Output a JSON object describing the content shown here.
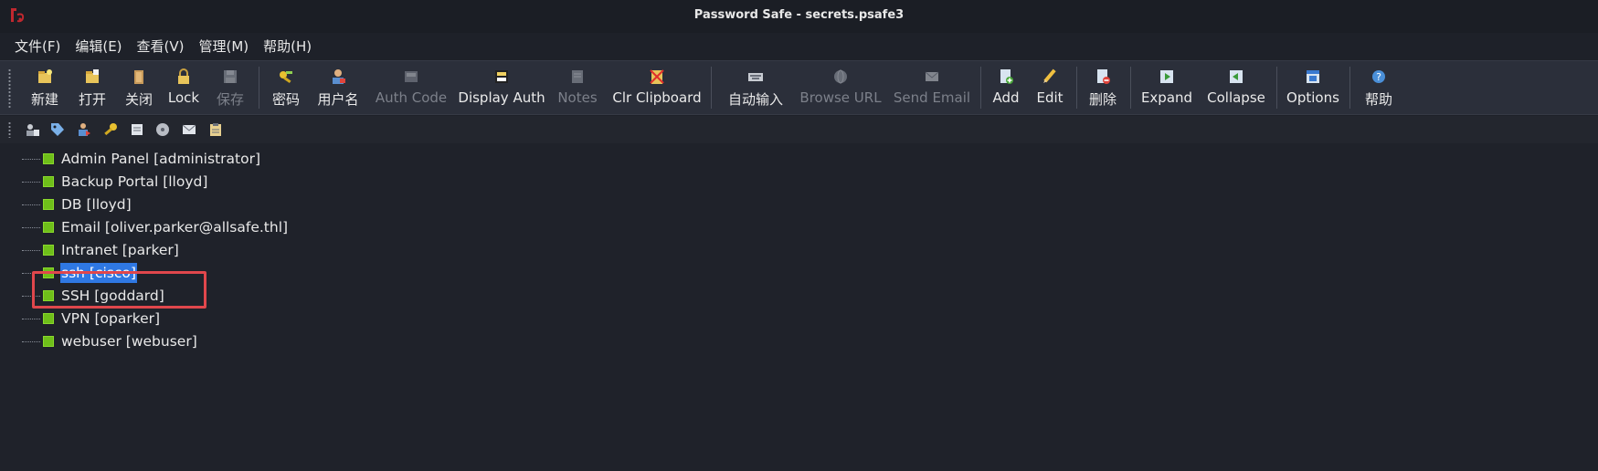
{
  "window": {
    "title": "Password Safe - secrets.psafe3"
  },
  "menu": [
    "文件(F)",
    "编辑(E)",
    "查看(V)",
    "管理(M)",
    "帮助(H)"
  ],
  "toolbar": [
    {
      "label": "新建",
      "icon": "new-icon",
      "enabled": true
    },
    {
      "label": "打开",
      "icon": "open-folder-icon",
      "enabled": true
    },
    {
      "label": "关闭",
      "icon": "close-db-icon",
      "enabled": true
    },
    {
      "label": "Lock",
      "icon": "lock-icon",
      "enabled": true
    },
    {
      "label": "保存",
      "icon": "save-icon",
      "enabled": false
    },
    {
      "label": "密码",
      "icon": "key-icon",
      "enabled": true
    },
    {
      "label": "用户名",
      "icon": "user-icon",
      "enabled": true
    },
    {
      "label": "Auth Code",
      "icon": "auth-code-icon",
      "enabled": false
    },
    {
      "label": "Display Auth",
      "icon": "display-auth-icon",
      "enabled": true
    },
    {
      "label": "Notes",
      "icon": "notes-icon",
      "enabled": false
    },
    {
      "label": "Clr Clipboard",
      "icon": "clear-clipboard-icon",
      "enabled": true
    },
    {
      "label": "自动输入",
      "icon": "autotype-icon",
      "enabled": true
    },
    {
      "label": "Browse URL",
      "icon": "globe-icon",
      "enabled": false
    },
    {
      "label": "Send Email",
      "icon": "email-icon",
      "enabled": false
    },
    {
      "label": "Add",
      "icon": "add-entry-icon",
      "enabled": true
    },
    {
      "label": "Edit",
      "icon": "edit-pencil-icon",
      "enabled": true
    },
    {
      "label": "删除",
      "icon": "delete-entry-icon",
      "enabled": true
    },
    {
      "label": "Expand",
      "icon": "expand-icon",
      "enabled": true
    },
    {
      "label": "Collapse",
      "icon": "collapse-icon",
      "enabled": true
    },
    {
      "label": "Options",
      "icon": "options-icon",
      "enabled": true
    },
    {
      "label": "帮助",
      "icon": "help-icon",
      "enabled": true
    }
  ],
  "toolbar2_icons": [
    "copy-user-icon",
    "tag-icon",
    "user-run-icon",
    "key-small-icon",
    "note-icon",
    "disc-icon",
    "envelope-icon",
    "clipboard-icon"
  ],
  "entries": [
    {
      "label": "Admin Panel [administrator]",
      "selected": false
    },
    {
      "label": "Backup Portal [lloyd]",
      "selected": false
    },
    {
      "label": "DB [lloyd]",
      "selected": false
    },
    {
      "label": "Email [oliver.parker@allsafe.thl]",
      "selected": false
    },
    {
      "label": "Intranet [parker]",
      "selected": false
    },
    {
      "label": "ssh [cisco]",
      "selected": true
    },
    {
      "label": "SSH [goddard]",
      "selected": false
    },
    {
      "label": "VPN [oparker]",
      "selected": false
    },
    {
      "label": "webuser [webuser]",
      "selected": false
    }
  ],
  "colors": {
    "selection": "#2f78e3",
    "leaf": "#6fbf1a",
    "highlight_box": "#e0474c"
  }
}
